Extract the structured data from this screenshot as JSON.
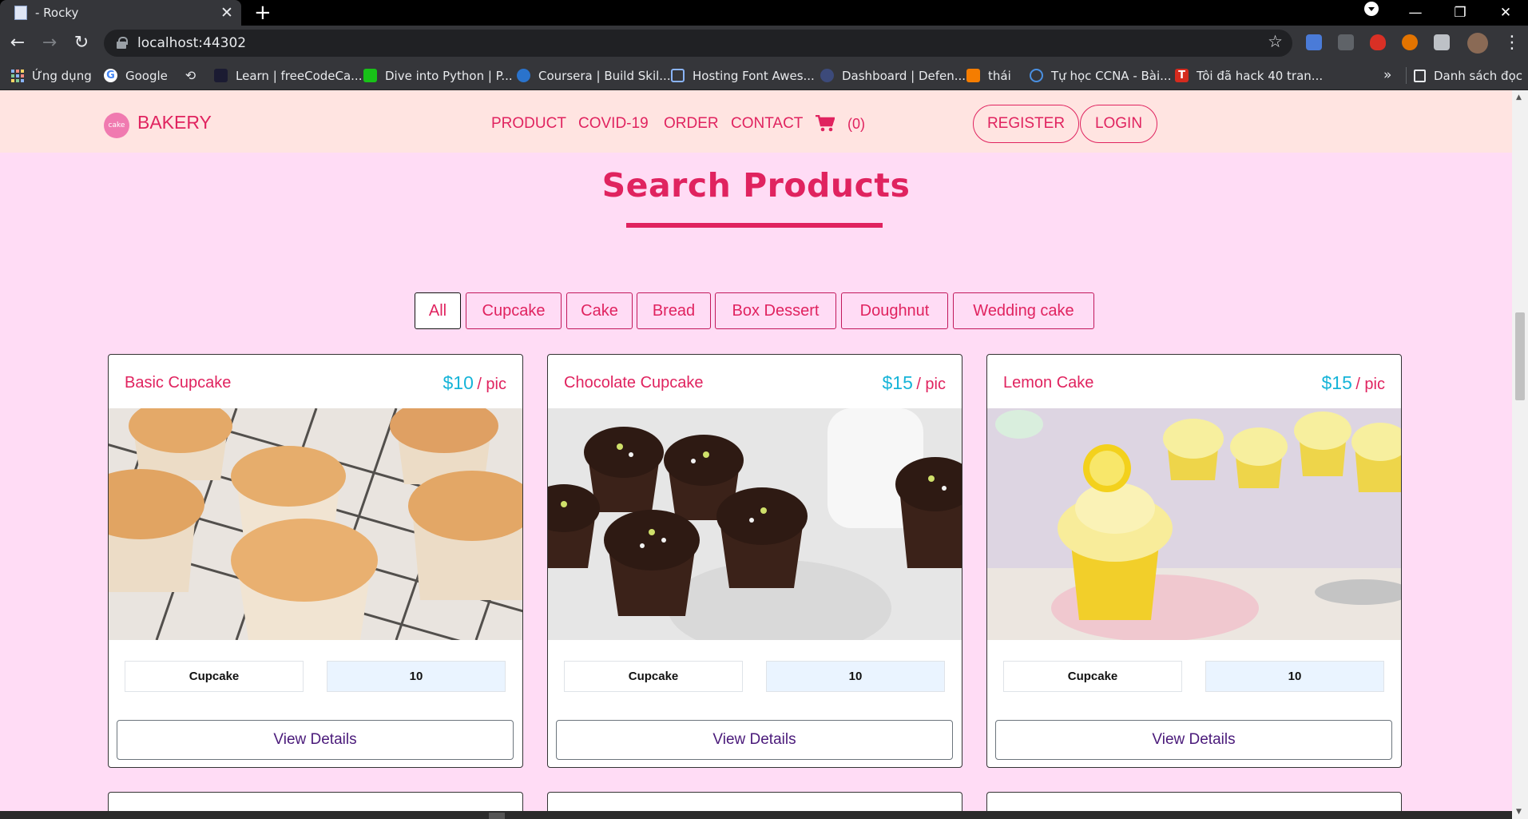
{
  "browser": {
    "tab_title": "- Rocky",
    "new_tab_symbol": "+",
    "url": "localhost:44302",
    "window_controls": [
      "—",
      "❐",
      "✕"
    ],
    "bookmarks": [
      {
        "label": "Ứng dụng",
        "icon": "apps-grid-icon"
      },
      {
        "label": "Google",
        "icon": "google-icon"
      },
      {
        "label": "",
        "icon": "history-icon"
      },
      {
        "label": "Learn | freeCodeCa...",
        "icon": "freecodecamp-icon"
      },
      {
        "label": "Dive into Python | P...",
        "icon": "diveintopython-icon"
      },
      {
        "label": "Coursera | Build Skil...",
        "icon": "coursera-icon"
      },
      {
        "label": "Hosting Font Awes...",
        "icon": "flag-icon"
      },
      {
        "label": "Dashboard | Defen...",
        "icon": "globe-icon"
      },
      {
        "label": "thái",
        "icon": "blogger-icon"
      },
      {
        "label": "Tự học CCNA - Bài...",
        "icon": "search-icon"
      },
      {
        "label": "Tôi đã hack 40 tran...",
        "icon": "t-icon"
      }
    ],
    "bookmarks_more": "»",
    "reading_list": "Danh sách đọc"
  },
  "header": {
    "brand": "BAKERY",
    "logo_text": "cake",
    "nav": [
      "PRODUCT",
      "COVID-19",
      "ORDER",
      "CONTACT"
    ],
    "cart_count": "(0)",
    "register": "REGISTER",
    "login": "LOGIN"
  },
  "main": {
    "title": "Search Products",
    "filters": [
      "All",
      "Cupcake",
      "Cake",
      "Bread",
      "Box Dessert",
      "Doughnut",
      "Wedding cake"
    ],
    "active_filter": "All",
    "products": [
      {
        "name": "Basic Cupcake",
        "price": "$10",
        "unit": "/ pic",
        "category": "Cupcake",
        "quantity": "10",
        "button": "View Details"
      },
      {
        "name": "Chocolate Cupcake",
        "price": "$15",
        "unit": "/ pic",
        "category": "Cupcake",
        "quantity": "10",
        "button": "View Details"
      },
      {
        "name": "Lemon Cake",
        "price": "$15",
        "unit": "/ pic",
        "category": "Cupcake",
        "quantity": "10",
        "button": "View Details"
      }
    ]
  },
  "colors": {
    "accent": "#e0235f",
    "price": "#16b4d8",
    "page_bg": "#ffdcf5",
    "header_bg": "#ffe4e1",
    "button_text": "#4a1a7a"
  }
}
